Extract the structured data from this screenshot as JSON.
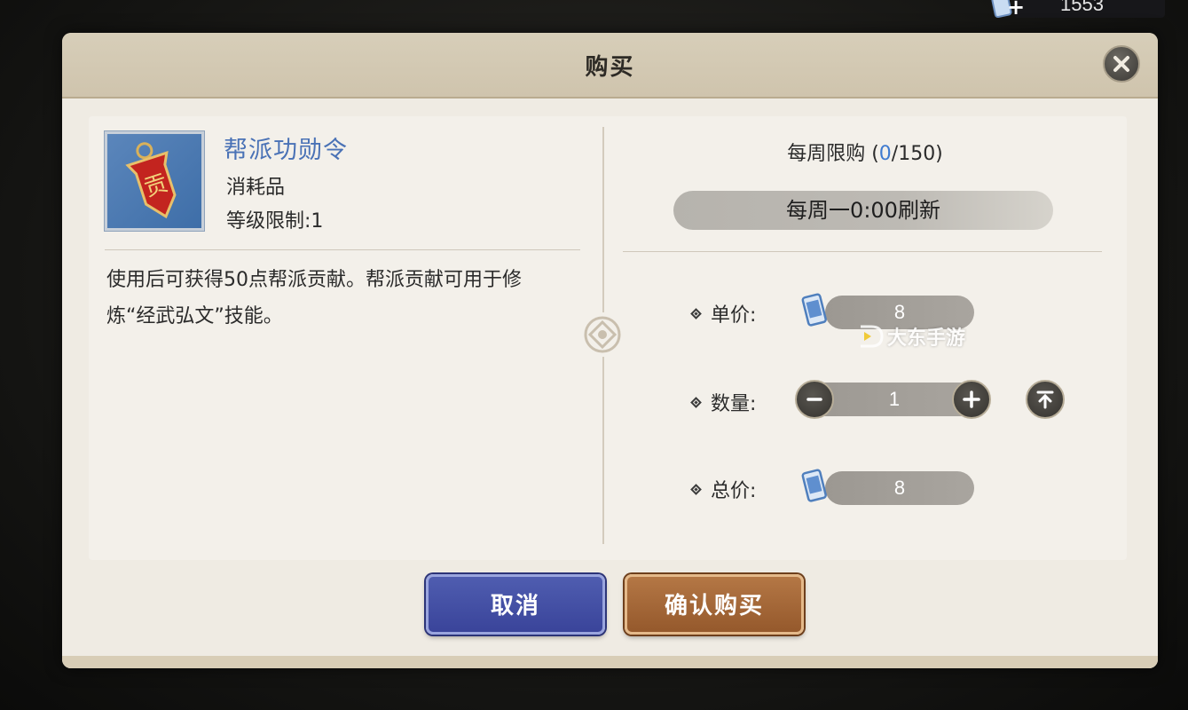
{
  "currency": {
    "amount": "1553",
    "icon": "coupon-ticket-icon",
    "add_icon": "plus-icon"
  },
  "dialog": {
    "title": "购买",
    "close_icon": "close-icon"
  },
  "item": {
    "name": "帮派功勋令",
    "type": "消耗品",
    "level_requirement": "等级限制:1",
    "description": "使用后可获得50点帮派贡献。帮派贡献可用于修炼“经武弘文”技能。",
    "icon_char": "贡"
  },
  "purchase": {
    "weekly_limit_label": "每周限购 (",
    "weekly_used": "0",
    "weekly_total": "/150)",
    "refresh_text": "每周一0:00刷新",
    "unit_price_label": "单价:",
    "unit_price": "8",
    "quantity_label": "数量:",
    "quantity": "1",
    "total_price_label": "总价:",
    "total_price": "8"
  },
  "watermark": "大东手游",
  "buttons": {
    "cancel": "取消",
    "confirm": "确认购买"
  },
  "colors": {
    "accent_blue": "#4a72b6",
    "cancel_button": "#3a449a",
    "confirm_button": "#95592c"
  }
}
